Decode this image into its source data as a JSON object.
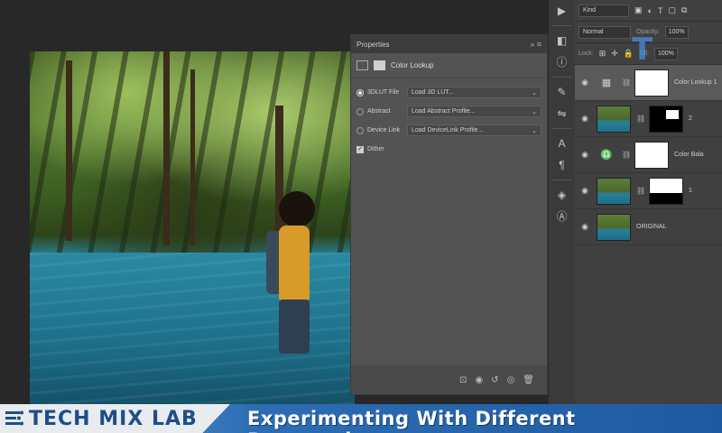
{
  "properties": {
    "header": "Properties",
    "title": "Color Lookup",
    "options": [
      {
        "label": "3DLUT File",
        "value": "Load 3D LUT...",
        "selected": true
      },
      {
        "label": "Abstract",
        "value": "Load Abstract Profile...",
        "selected": false
      },
      {
        "label": "Device Link",
        "value": "Load DeviceLink Profile...",
        "selected": false
      }
    ],
    "dither_label": "Dither",
    "dither_checked": true
  },
  "layers_panel": {
    "kind": "Kind",
    "blend_mode": "Normal",
    "opacity_label": "Opacity:",
    "opacity": "100%",
    "lock_label": "Lock:",
    "fill_label": "Fill:",
    "fill": "100%",
    "layers": [
      {
        "name": "Color Lookup 1",
        "selected": true
      },
      {
        "name": "2",
        "selected": false
      },
      {
        "name": "Color Bala",
        "selected": false
      },
      {
        "name": "1",
        "selected": false
      },
      {
        "name": "ORIGINAL",
        "selected": false
      }
    ]
  },
  "banner": {
    "brand": "TECH MIX LAB",
    "headline": "Experimenting With Different Perspectives"
  },
  "colors": {
    "banner_blue": "#2d6db5",
    "brand_text": "#1e4d8a",
    "panel": "#535353"
  }
}
